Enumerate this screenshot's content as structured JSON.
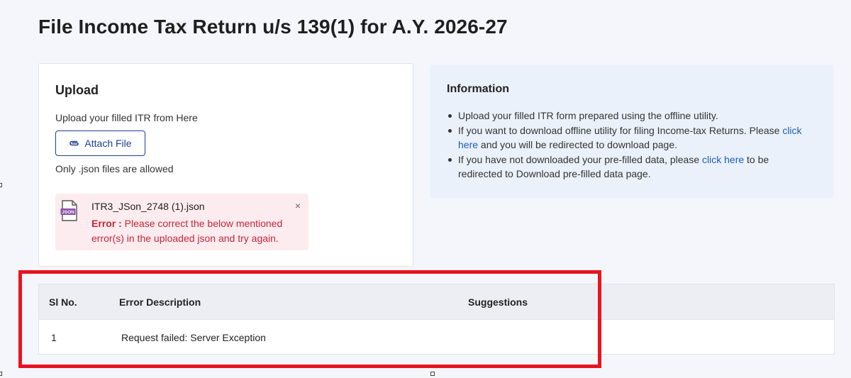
{
  "page": {
    "title": "File Income Tax Return u/s 139(1) for A.Y. 2026-27"
  },
  "upload": {
    "heading": "Upload",
    "subtitle": "Upload your filled ITR from Here",
    "attach_label": "Attach File",
    "allowed_note": "Only .json files are allowed",
    "file": {
      "icon_label": "JSON",
      "name": "ITR3_JSon_2748 (1).json",
      "close": "×",
      "error_label": "Error :",
      "error_message": " Please correct the below mentioned error(s) in the uploaded json and try again."
    }
  },
  "info": {
    "heading": "Information",
    "item1": "Upload your filled ITR form prepared using the offline utility.",
    "item2_before": "If you want to download offline utility for filing Income-tax Returns. Please ",
    "item2_link": "click here",
    "item2_after": " and you will be redirected to download page.",
    "item3_before": "If you have not downloaded your pre-filled data, please ",
    "item3_link": "click here",
    "item3_after": " to be redirected to Download pre-filled data page."
  },
  "error_table": {
    "headers": {
      "sl": "Sl No.",
      "description": "Error Description",
      "suggestions": "Suggestions"
    },
    "rows": [
      {
        "sl": "1",
        "description": "Request failed: Server Exception",
        "suggestions": ""
      }
    ]
  },
  "colors": {
    "primary": "#1d3f92",
    "link": "#1a5fb4",
    "error": "#c0263a",
    "error_bg": "#fdecef",
    "info_bg": "#eaf1fb",
    "highlight": "#e8141f"
  }
}
